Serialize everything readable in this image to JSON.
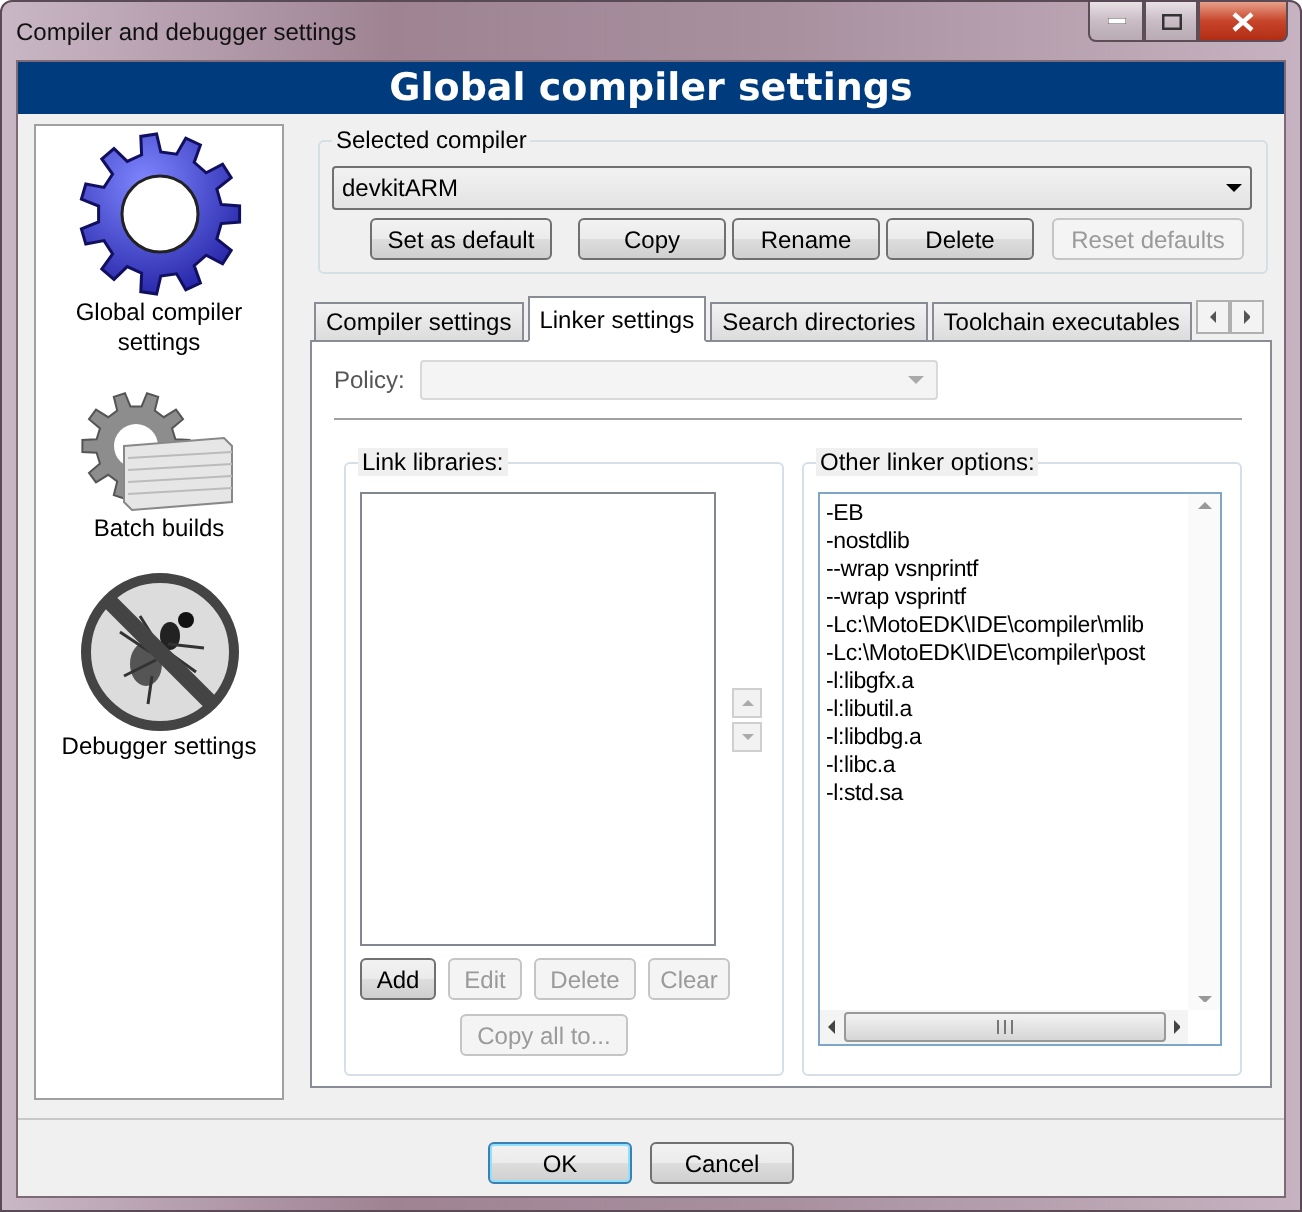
{
  "window": {
    "title": "Compiler and debugger settings"
  },
  "header": {
    "title": "Global compiler settings"
  },
  "sidebar": {
    "items": [
      {
        "label": "Global compiler settings",
        "kind": "gear"
      },
      {
        "label": "Batch builds",
        "kind": "batch"
      },
      {
        "label": "Debugger settings",
        "kind": "debugger"
      }
    ]
  },
  "compiler": {
    "group_label": "Selected compiler",
    "value": "devkitARM",
    "buttons": [
      {
        "label": "Set as default",
        "disabled": false
      },
      {
        "label": "Copy",
        "disabled": false
      },
      {
        "label": "Rename",
        "disabled": false
      },
      {
        "label": "Delete",
        "disabled": false
      },
      {
        "label": "Reset defaults",
        "disabled": true
      }
    ]
  },
  "tabs": [
    {
      "label": "Compiler settings",
      "selected": false
    },
    {
      "label": "Linker settings",
      "selected": true
    },
    {
      "label": "Search directories",
      "selected": false
    },
    {
      "label": "Toolchain executables",
      "selected": false
    }
  ],
  "policy": {
    "label": "Policy:",
    "disabled": true
  },
  "link_libraries": {
    "label": "Link libraries:",
    "buttons": [
      {
        "label": "Add",
        "disabled": false
      },
      {
        "label": "Edit",
        "disabled": true
      },
      {
        "label": "Delete",
        "disabled": true
      },
      {
        "label": "Clear",
        "disabled": true
      }
    ],
    "copy_button": {
      "label": "Copy all to...",
      "disabled": true
    }
  },
  "other_options": {
    "label": "Other linker options:",
    "lines": [
      "-EB",
      "-nostdlib",
      "--wrap vsnprintf",
      "--wrap vsprintf",
      "-Lc:\\MotoEDK\\IDE\\compiler\\mlib",
      "-Lc:\\MotoEDK\\IDE\\compiler\\post",
      "-l:libgfx.a",
      "-l:libutil.a",
      "-l:libdbg.a",
      "-l:libc.a",
      "-l:std.sa"
    ]
  },
  "dialog_buttons": [
    {
      "label": "OK",
      "default": true
    },
    {
      "label": "Cancel",
      "default": false
    }
  ]
}
